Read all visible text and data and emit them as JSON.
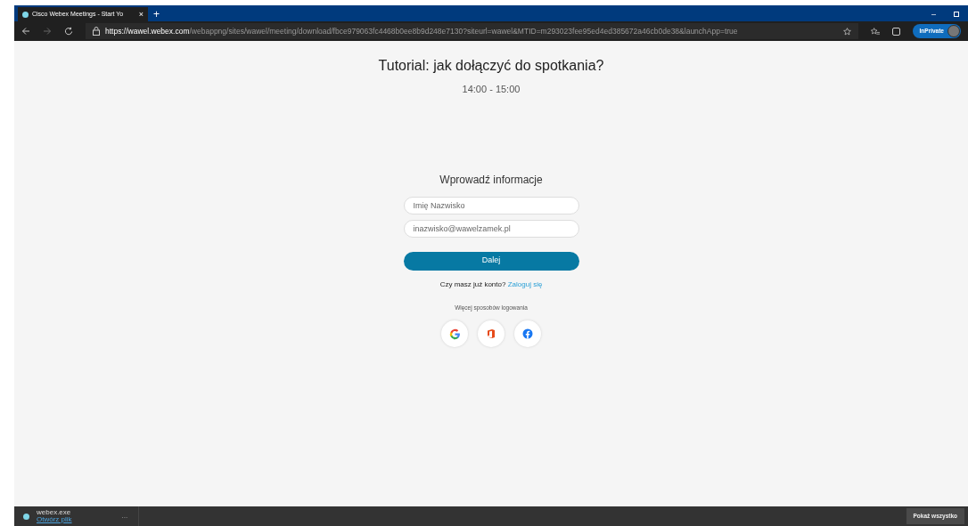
{
  "browser": {
    "tab_title": "Cisco Webex Meetings - Start Yo",
    "tab_close": "×",
    "new_tab": "+",
    "url_host": "https://wawel.webex.com",
    "url_path": "/webappng/sites/wawel/meeting/download/fbce979063fc4468b0ee8b9d248e7130?siteurl=wawel&MTID=m293023fee95ed4ed385672a46cb0de38&launchApp=true",
    "profile_label": "InPrivate",
    "minimize": "–"
  },
  "page": {
    "title": "Tutorial: jak dołączyć do spotkania?",
    "time": "14:00 - 15:00",
    "form_heading": "Wprowadź informacje",
    "fields": [
      {
        "placeholder": "Imię Nazwisko"
      },
      {
        "placeholder": "inazwisko@wawelzamek.pl"
      }
    ],
    "submit": "Dalej",
    "account_prompt": "Czy masz już konto?",
    "login_link": "Zaloguj się",
    "more_options": "Więcej sposobów logowania",
    "providers": [
      {
        "kind": "google"
      },
      {
        "kind": "office"
      },
      {
        "kind": "facebook"
      }
    ]
  },
  "download_bar": {
    "file_name": "webex.exe",
    "open_link": "Otwórz plik",
    "more": "...",
    "show_all": "Pokaż wszystko"
  }
}
